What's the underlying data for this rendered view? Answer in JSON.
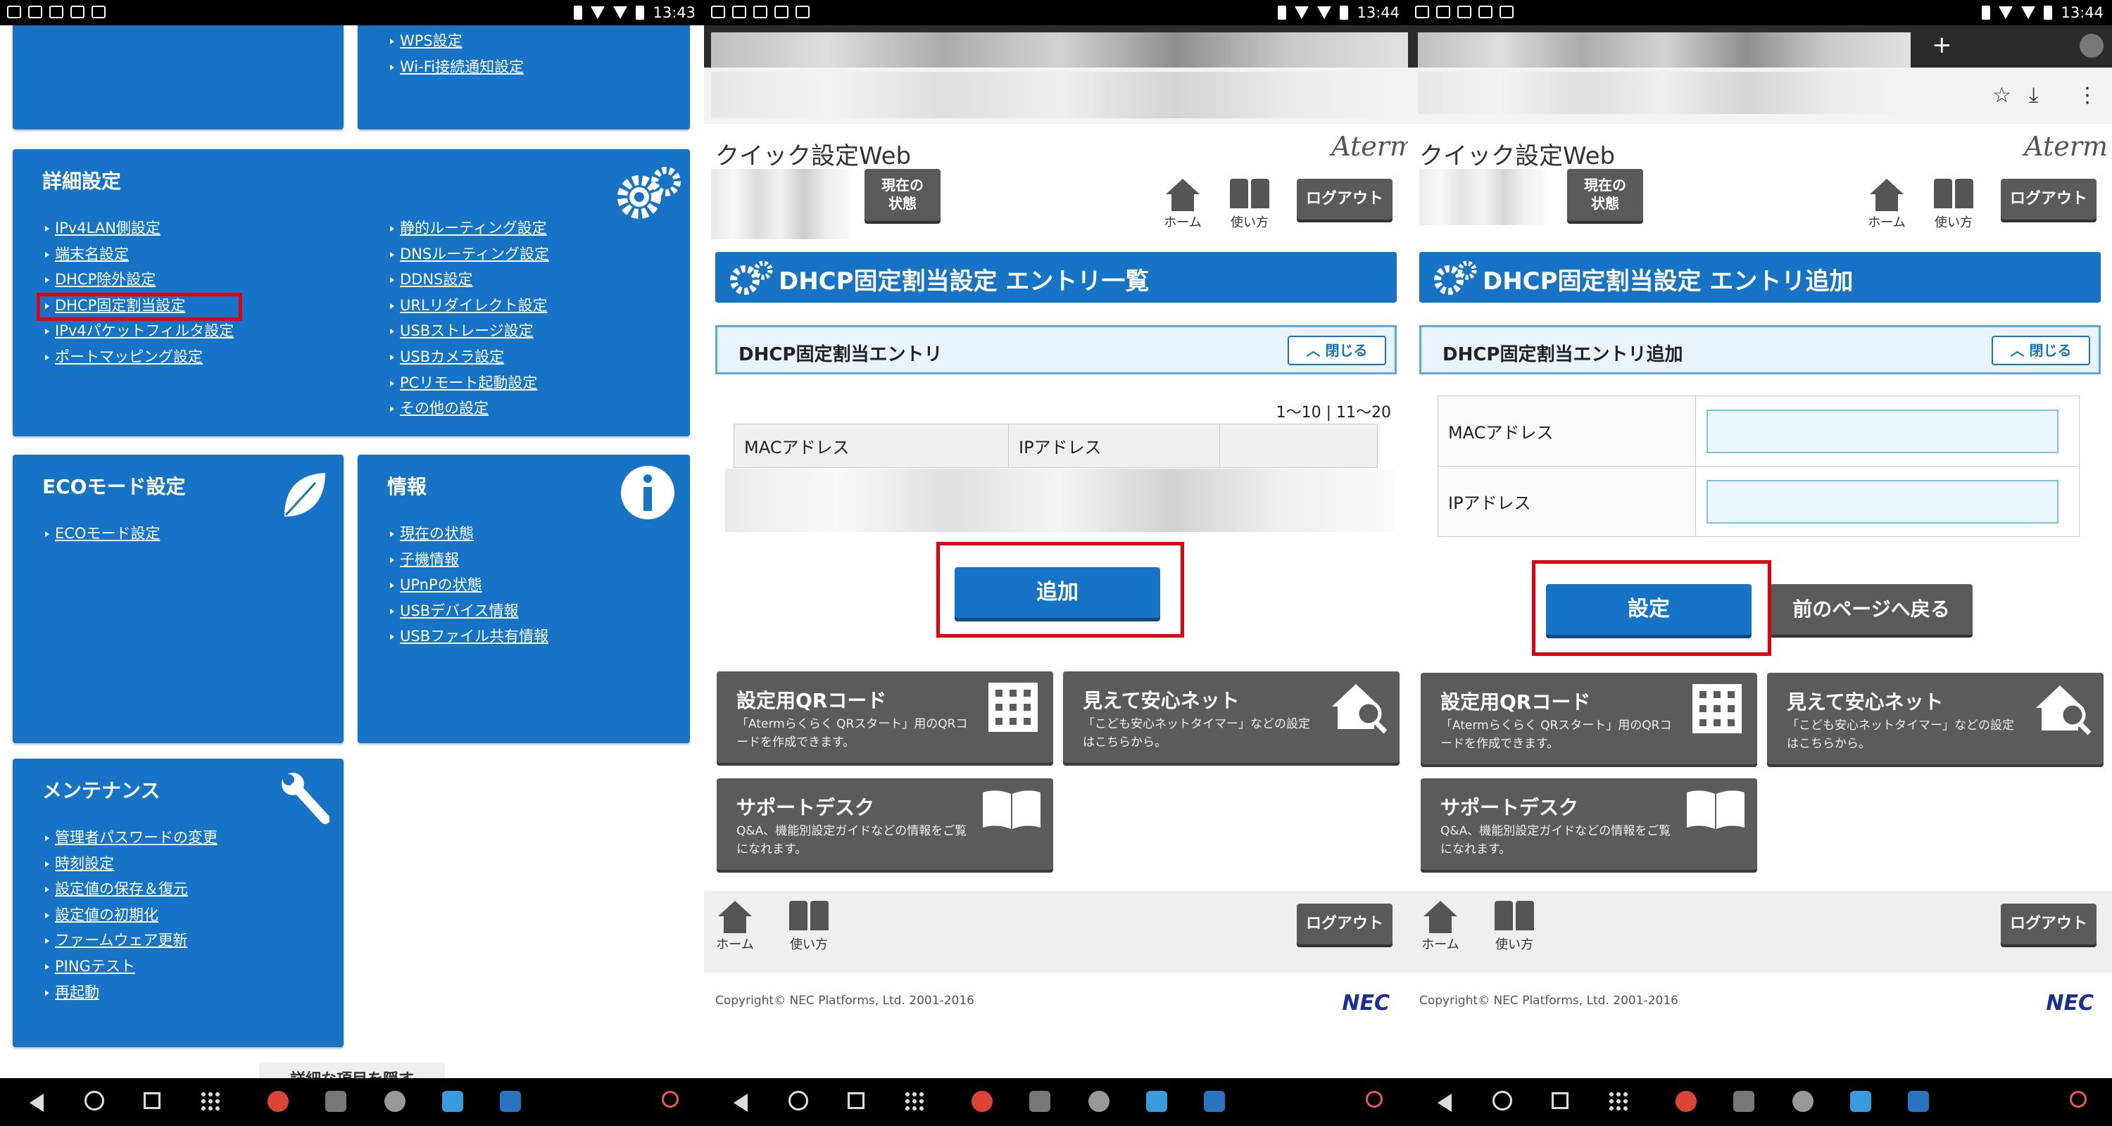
{
  "status": {
    "p1_time": "13:43",
    "p2_time": "13:44",
    "p3_time": "13:44"
  },
  "panel1": {
    "wifi_links": [
      "WPS設定",
      "Wi-Fi接続通知設定"
    ],
    "detail": {
      "title": "詳細設定",
      "left": [
        "IPv4LAN側設定",
        "端末名設定",
        "DHCP除外設定",
        "DHCP固定割当設定",
        "IPv4パケットフィルタ設定",
        "ポートマッピング設定"
      ],
      "right": [
        "静的ルーティング設定",
        "DNSルーティング設定",
        "DDNS設定",
        "URLリダイレクト設定",
        "USBストレージ設定",
        "USBカメラ設定",
        "PCリモート起動設定",
        "その他の設定"
      ]
    },
    "eco": {
      "title": "ECOモード設定",
      "items": [
        "ECOモード設定"
      ]
    },
    "info": {
      "title": "情報",
      "items": [
        "現在の状態",
        "子機情報",
        "UPnPの状態",
        "USBデバイス情報",
        "USBファイル共有情報"
      ]
    },
    "maint": {
      "title": "メンテナンス",
      "items": [
        "管理者パスワードの変更",
        "時刻設定",
        "設定値の保存＆復元",
        "設定値の初期化",
        "ファームウェア更新",
        "PINGテスト",
        "再起動"
      ]
    },
    "bottom_btn": "詳細な項目を隠す"
  },
  "common": {
    "site_title": "クイック設定Web",
    "brand": "Aterm",
    "status_btn": "現在の\n状態",
    "home": "ホーム",
    "howto": "使い方",
    "logout": "ログアウト",
    "close": "閉じる",
    "qr_title": "設定用QRコード",
    "qr_desc1": "「Atermらくらく QRスタート」用のQRコ",
    "qr_desc2": "ードを作成できます。",
    "safe_title": "見えて安心ネット",
    "safe_desc1": "「こども安心ネットタイマー」などの設定",
    "safe_desc2": "はこちらから。",
    "support_title": "サポートデスク",
    "support_desc1": "Q&A、機能別設定ガイドなどの情報をご覧",
    "support_desc2": "になれます。",
    "copyright": "Copyright© NEC Platforms, Ltd. 2001-2016",
    "nec": "NEC"
  },
  "panel2": {
    "heading": "DHCP固定割当設定 エントリ一覧",
    "subheading": "DHCP固定割当エントリ",
    "pager": "1〜10 | 11〜20",
    "col_mac": "MACアドレス",
    "col_ip": "IPアドレス",
    "add_btn": "追加"
  },
  "panel3": {
    "heading": "DHCP固定割当設定 エントリ追加",
    "subheading": "DHCP固定割当エントリ追加",
    "label_mac": "MACアドレス",
    "label_ip": "IPアドレス",
    "set_btn": "設定",
    "back_btn": "前のページへ戻る",
    "new_tab": "+"
  },
  "colors": {
    "accent": "#1673c5",
    "highlight": "#e0000f",
    "tile": "#5b5b5b"
  }
}
